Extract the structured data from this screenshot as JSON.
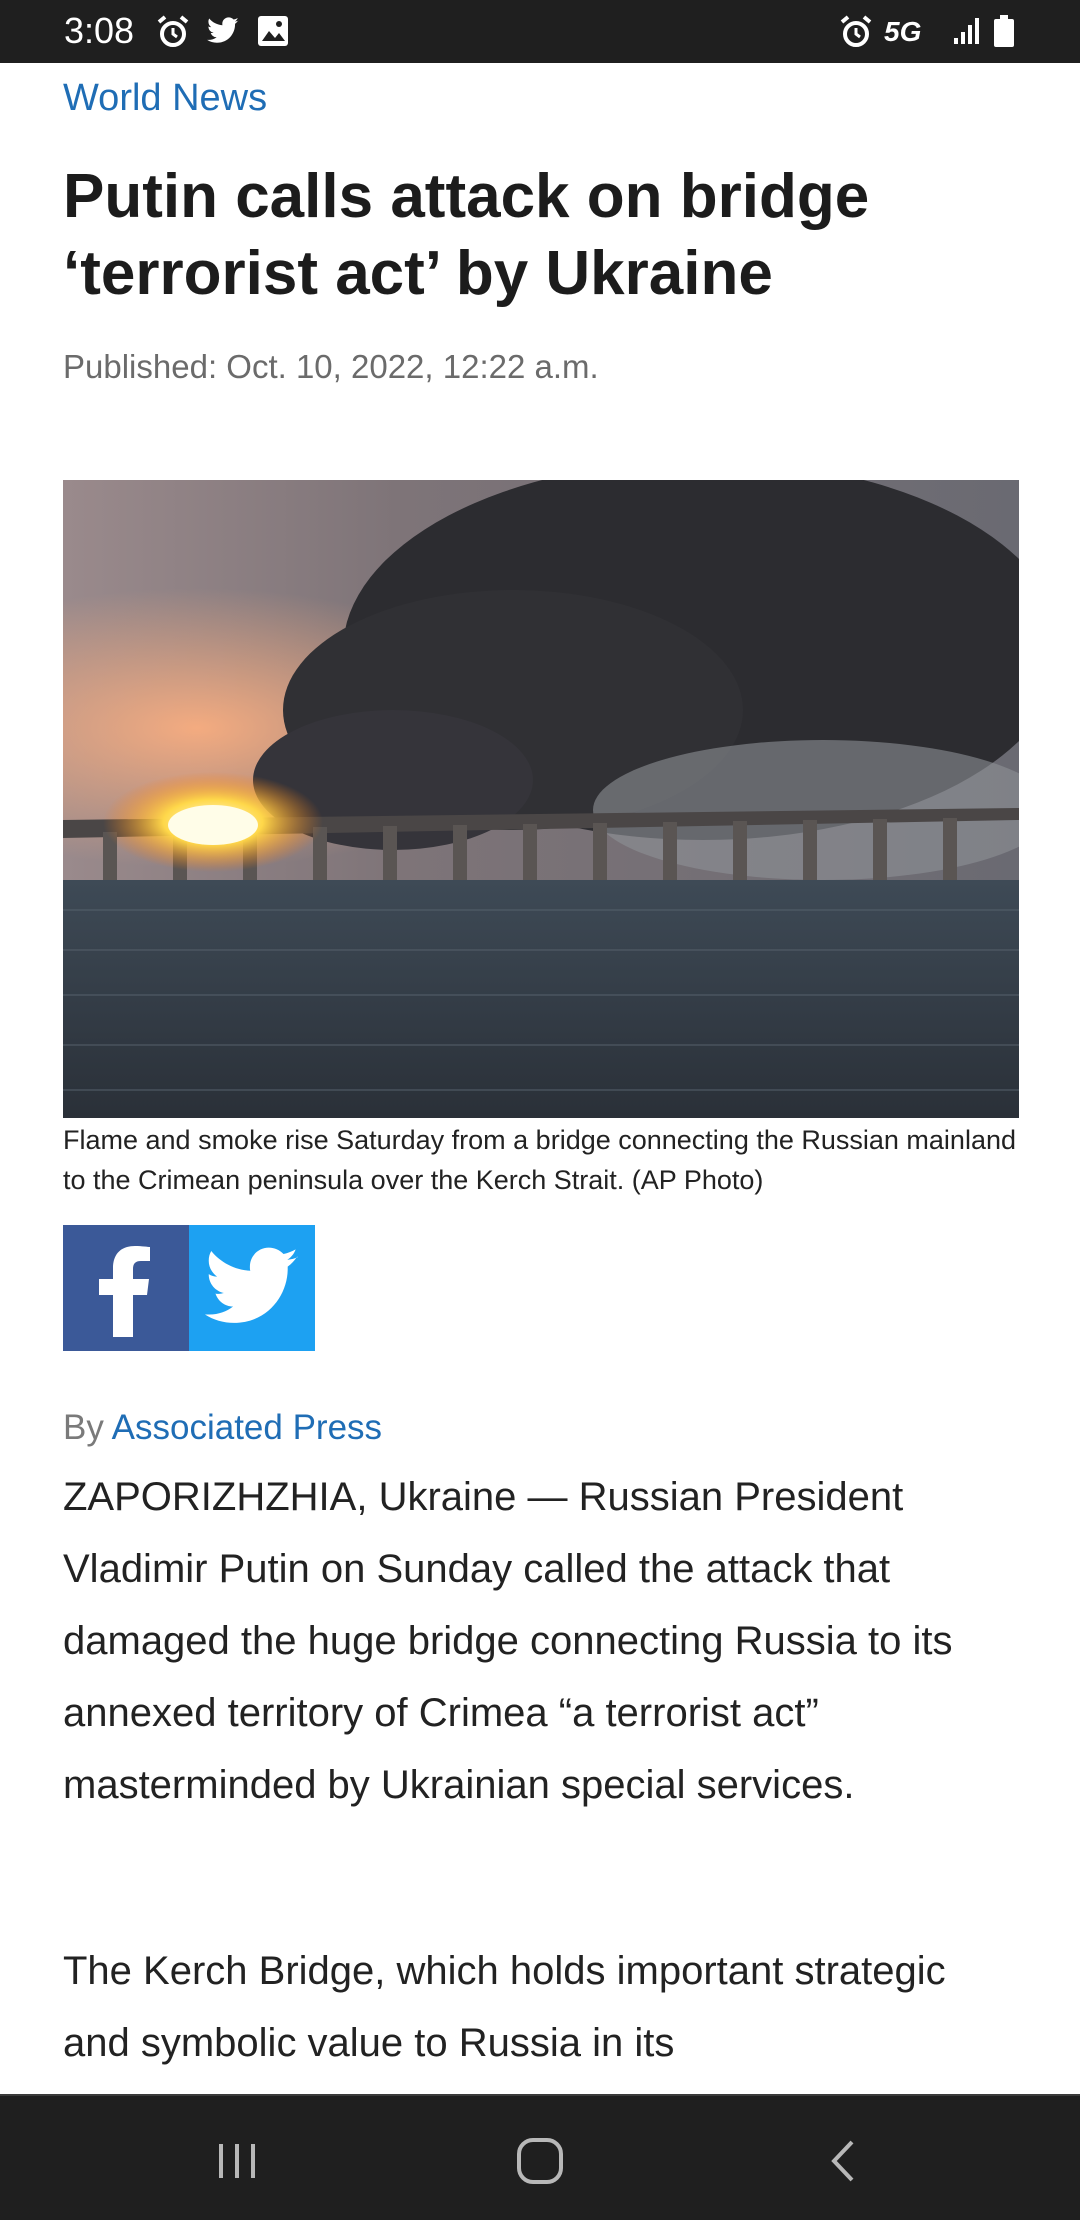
{
  "status_bar": {
    "time": "3:08",
    "left_icons": [
      "alarm-icon",
      "twitter-bird-icon",
      "gallery-icon"
    ],
    "right_icons": [
      "alarm-icon",
      "network-5g-icon",
      "signal-icon",
      "battery-icon"
    ],
    "network_label": "5G"
  },
  "article": {
    "section": "World News",
    "headline": "Putin calls attack on bridge ‘terrorist act’ by Ukraine",
    "published": "Published: Oct. 10, 2022, 12:22 a.m.",
    "photo_caption": "Flame and smoke rise Saturday from a bridge connecting the Russian mainland to the Crimean peninsula over the Kerch Strait. (AP Photo)",
    "byline_prefix": "By",
    "byline_author": "Associated Press",
    "paragraphs": [
      "ZAPORIZHZHIA, Ukraine — Russian President Vladimir Putin on Sunday called the attack that damaged the huge bridge connecting Russia to its annexed territory of Crimea “a terrorist act” masterminded by Ukrainian special services.",
      "The Kerch Bridge, which holds important strategic and symbolic value to Russia in its"
    ]
  },
  "share": {
    "facebook_icon": "facebook-icon",
    "twitter_icon": "twitter-icon",
    "facebook_color": "#3b5998",
    "twitter_color": "#1da1f2"
  },
  "nav_bar": {
    "buttons": [
      "recents-icon",
      "home-icon",
      "back-icon"
    ]
  },
  "colors": {
    "link": "#1f6db5",
    "bars": "#1f1f1f"
  }
}
